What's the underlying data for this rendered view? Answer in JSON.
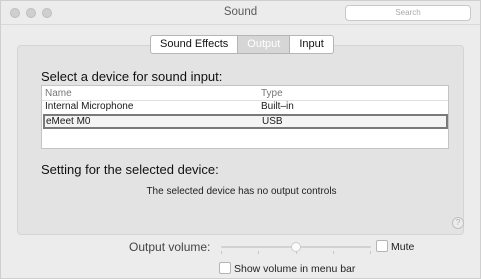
{
  "window": {
    "title": "Sound",
    "search_placeholder": "Search"
  },
  "tabs": [
    {
      "label": "Sound Effects",
      "active": false
    },
    {
      "label": "Output",
      "active": true
    },
    {
      "label": "Input",
      "active": false
    }
  ],
  "input": {
    "heading": "Select a device for sound input:",
    "columns": {
      "name": "Name",
      "type": "Type"
    },
    "devices": [
      {
        "name": "Internal Microphone",
        "type": "Built–in",
        "selected": false
      },
      {
        "name": "eMeet M0",
        "type": "USB",
        "selected": true
      }
    ],
    "settings_heading": "Setting for the selected device:",
    "note": "The selected device has no output controls"
  },
  "volume": {
    "label": "Output volume:",
    "level": 0.5,
    "mute_label": "Mute",
    "mute_checked": false,
    "menubar_label": "Show volume in menu bar",
    "menubar_checked": false
  },
  "help": "?"
}
